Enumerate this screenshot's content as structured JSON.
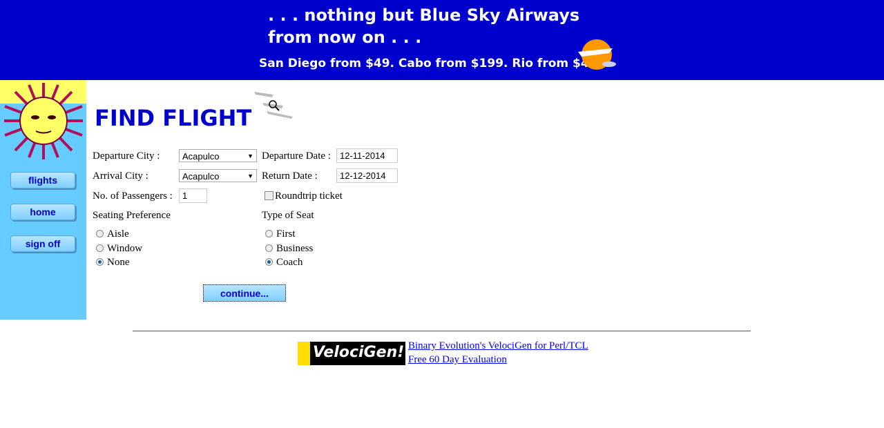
{
  "banner": {
    "line1": ". . . nothing but Blue Sky Airways",
    "line2": "from now on . . .",
    "line3": "San Diego from $49. Cabo from $199. Rio from $499."
  },
  "sidebar": {
    "items": [
      {
        "label": "flights"
      },
      {
        "label": "home"
      },
      {
        "label": "sign off"
      }
    ]
  },
  "page_title": "FIND FLIGHT",
  "form": {
    "departure_city_label": "Departure City :",
    "departure_city_value": "Acapulco",
    "arrival_city_label": "Arrival City :",
    "arrival_city_value": "Acapulco",
    "departure_date_label": "Departure Date :",
    "departure_date_value": "12-11-2014",
    "return_date_label": "Return Date :",
    "return_date_value": "12-12-2014",
    "passengers_label": "No. of Passengers :",
    "passengers_value": "1",
    "roundtrip_label": "Roundtrip ticket",
    "seating_label": "Seating Preference",
    "seating_options": [
      "Aisle",
      "Window",
      "None"
    ],
    "seat_type_label": "Type of Seat",
    "seat_type_options": [
      "First",
      "Business",
      "Coach"
    ],
    "continue_label": "continue..."
  },
  "footer": {
    "logo_text": "Powered By VelociGen!",
    "link1": "Binary Evolution's VelociGen for Perl/TCL",
    "link2": "Free 60 Day Evaluation"
  }
}
